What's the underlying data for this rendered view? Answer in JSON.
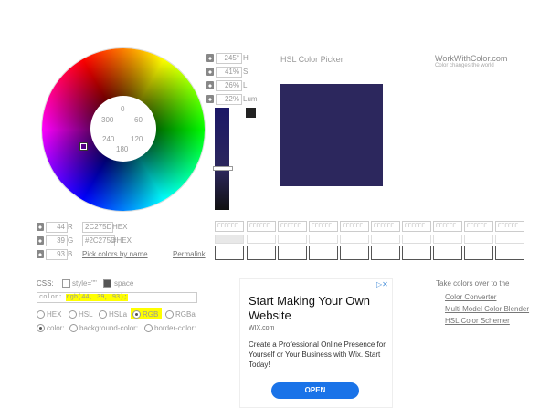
{
  "brand": {
    "name": "WorkWithColor.com",
    "tagline": "Color changes the world"
  },
  "title": "HSL Color Picker",
  "wheel": {
    "degrees": [
      "0",
      "60",
      "120",
      "180",
      "240",
      "300"
    ]
  },
  "hsl": {
    "h": {
      "value": "245°",
      "label": "H"
    },
    "s": {
      "value": "41%",
      "label": "S"
    },
    "l": {
      "value": "26%",
      "label": "L"
    },
    "lum": {
      "value": "22%",
      "label": "Lum"
    }
  },
  "rgb": {
    "r": {
      "value": "44",
      "label": "R"
    },
    "g": {
      "value": "39",
      "label": "G"
    },
    "b": {
      "value": "93",
      "label": "B"
    }
  },
  "hex": {
    "value": "2C275D",
    "label": "HEX",
    "hash_value": "#2C275D",
    "hash_label": "#HEX"
  },
  "links": {
    "pick_by_name": "Pick colors by name",
    "permalink": "Permalink"
  },
  "palette": {
    "placeholder": "FFFFFF",
    "count": 10
  },
  "css": {
    "label": "CSS:",
    "style_option": "style=\"\"",
    "space_option": "space",
    "field_prefix": "color:",
    "field_value": "rgb(44, 39, 93);",
    "formats": [
      "HEX",
      "HSL",
      "HSLa",
      "RGB",
      "RGBa"
    ],
    "properties": [
      "color:",
      "background-color:",
      "border-color:"
    ]
  },
  "take_colors": {
    "heading": "Take colors over to the",
    "links": [
      "Color Converter",
      "Multi Model Color Blender",
      "HSL Color Schemer"
    ]
  },
  "ad": {
    "title": "Start Making Your Own Website",
    "url": "WIX.com",
    "text": "Create a Professional Online Presence for Yourself or Your Business with Wix. Start Today!",
    "button": "OPEN"
  },
  "colors": {
    "selected": "#2c275d",
    "highlight": "#ffff00",
    "ad_button": "#1a73e8"
  }
}
